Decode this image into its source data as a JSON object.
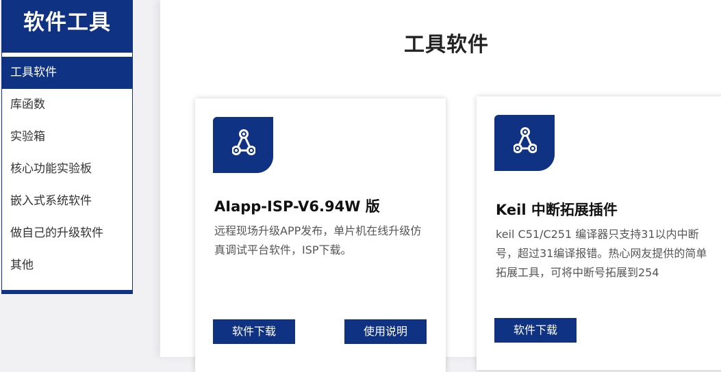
{
  "sidebar": {
    "title": "软件工具",
    "items": [
      {
        "label": "工具软件",
        "active": true
      },
      {
        "label": "库函数"
      },
      {
        "label": "实验箱"
      },
      {
        "label": "核心功能实验板"
      },
      {
        "label": "嵌入式系统软件"
      },
      {
        "label": "做自己的升级软件"
      },
      {
        "label": "其他"
      }
    ]
  },
  "main": {
    "title": "工具软件",
    "cards": [
      {
        "icon": "share-network-icon",
        "title": "AIapp-ISP-V6.94W 版",
        "desc": "远程现场升级APP发布，单片机在线升级仿真调试平台软件，ISP下载。",
        "download_label": "软件下载",
        "manual_label": "使用说明"
      },
      {
        "icon": "share-network-icon",
        "title": "Keil 中断拓展插件",
        "desc": "keil C51/C251 编译器只支持31以内中断号，超过31编译报错。热心网友提供的简单拓展工具，可将中断号拓展到254",
        "download_label": "软件下载"
      }
    ]
  },
  "colors": {
    "brand": "#0f3282"
  }
}
